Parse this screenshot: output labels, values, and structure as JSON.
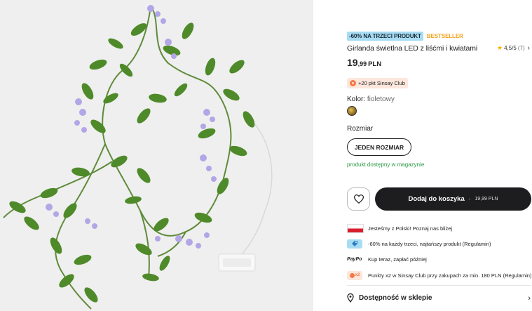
{
  "product": {
    "badge_sale": "-60% NA TRZECI PRODUKT",
    "badge_best": "BESTSELLER",
    "title": "Girlanda świetlna LED z liśćmi i kwiatami",
    "rating": "4,5/5",
    "rating_count": "(7)",
    "price_int": "19",
    "price_dec": ",99",
    "price_cur": "PLN",
    "points": "+20 pkt Sinsay Club",
    "color_label": "Kolor:",
    "color_value": "fioletowy",
    "size_label": "Rozmiar",
    "size_option": "JEDEN ROZMIAR",
    "stock": "produkt dostępny w magazynie"
  },
  "actions": {
    "add_to_cart": "Dodaj do koszyka",
    "separator": "-",
    "cart_price": "19,99 PLN"
  },
  "info": [
    {
      "icon": "poland-flag-icon",
      "text": "Jesteśmy z Polski! Poznaj nas bliżej"
    },
    {
      "icon": "tag-icon",
      "text": "-60% na każdy trzeci, najtańszy produkt (Regulamin)"
    },
    {
      "icon": "paypo-logo",
      "text": "Kup teraz, zapłać później",
      "logo_text": "PayPo"
    },
    {
      "icon": "coin-x2-icon",
      "text": "Punkty x2 w Sinsay Club przy zakupach za min. 180 PLN (Regulamin)",
      "badge_text": "x2"
    }
  ],
  "store": {
    "label": "Dostępność w sklepie"
  },
  "colors": {
    "sale_badge": "#a7dcf3",
    "bestseller": "#f0a21b",
    "stock_green": "#2c9a46",
    "cart_button": "#1d1d1f",
    "points_bg": "#fde6dc",
    "points_coin": "#f37a45",
    "star": "#f5b301"
  }
}
